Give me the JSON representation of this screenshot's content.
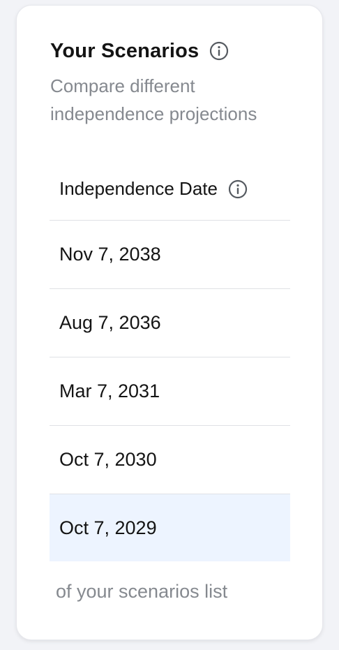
{
  "card": {
    "title": "Your Scenarios",
    "subtitle": "Compare different independence projections",
    "title_icon": "info-icon"
  },
  "table": {
    "column_header": "Independence Date",
    "header_icon": "info-icon",
    "rows": [
      {
        "date": "Nov 7, 2038"
      },
      {
        "date": "Aug 7, 2036"
      },
      {
        "date": "Mar 7, 2031"
      },
      {
        "date": "Oct 7, 2030"
      },
      {
        "date": "Oct 7, 2029"
      }
    ],
    "highlighted_row_index": 4
  },
  "footer": {
    "note": "of your scenarios list"
  },
  "colors": {
    "background": "#f2f3f7",
    "card": "#ffffff",
    "highlight": "#edf4ff",
    "muted_text": "#85898f",
    "text": "#141414",
    "divider": "#dfe1e5"
  }
}
